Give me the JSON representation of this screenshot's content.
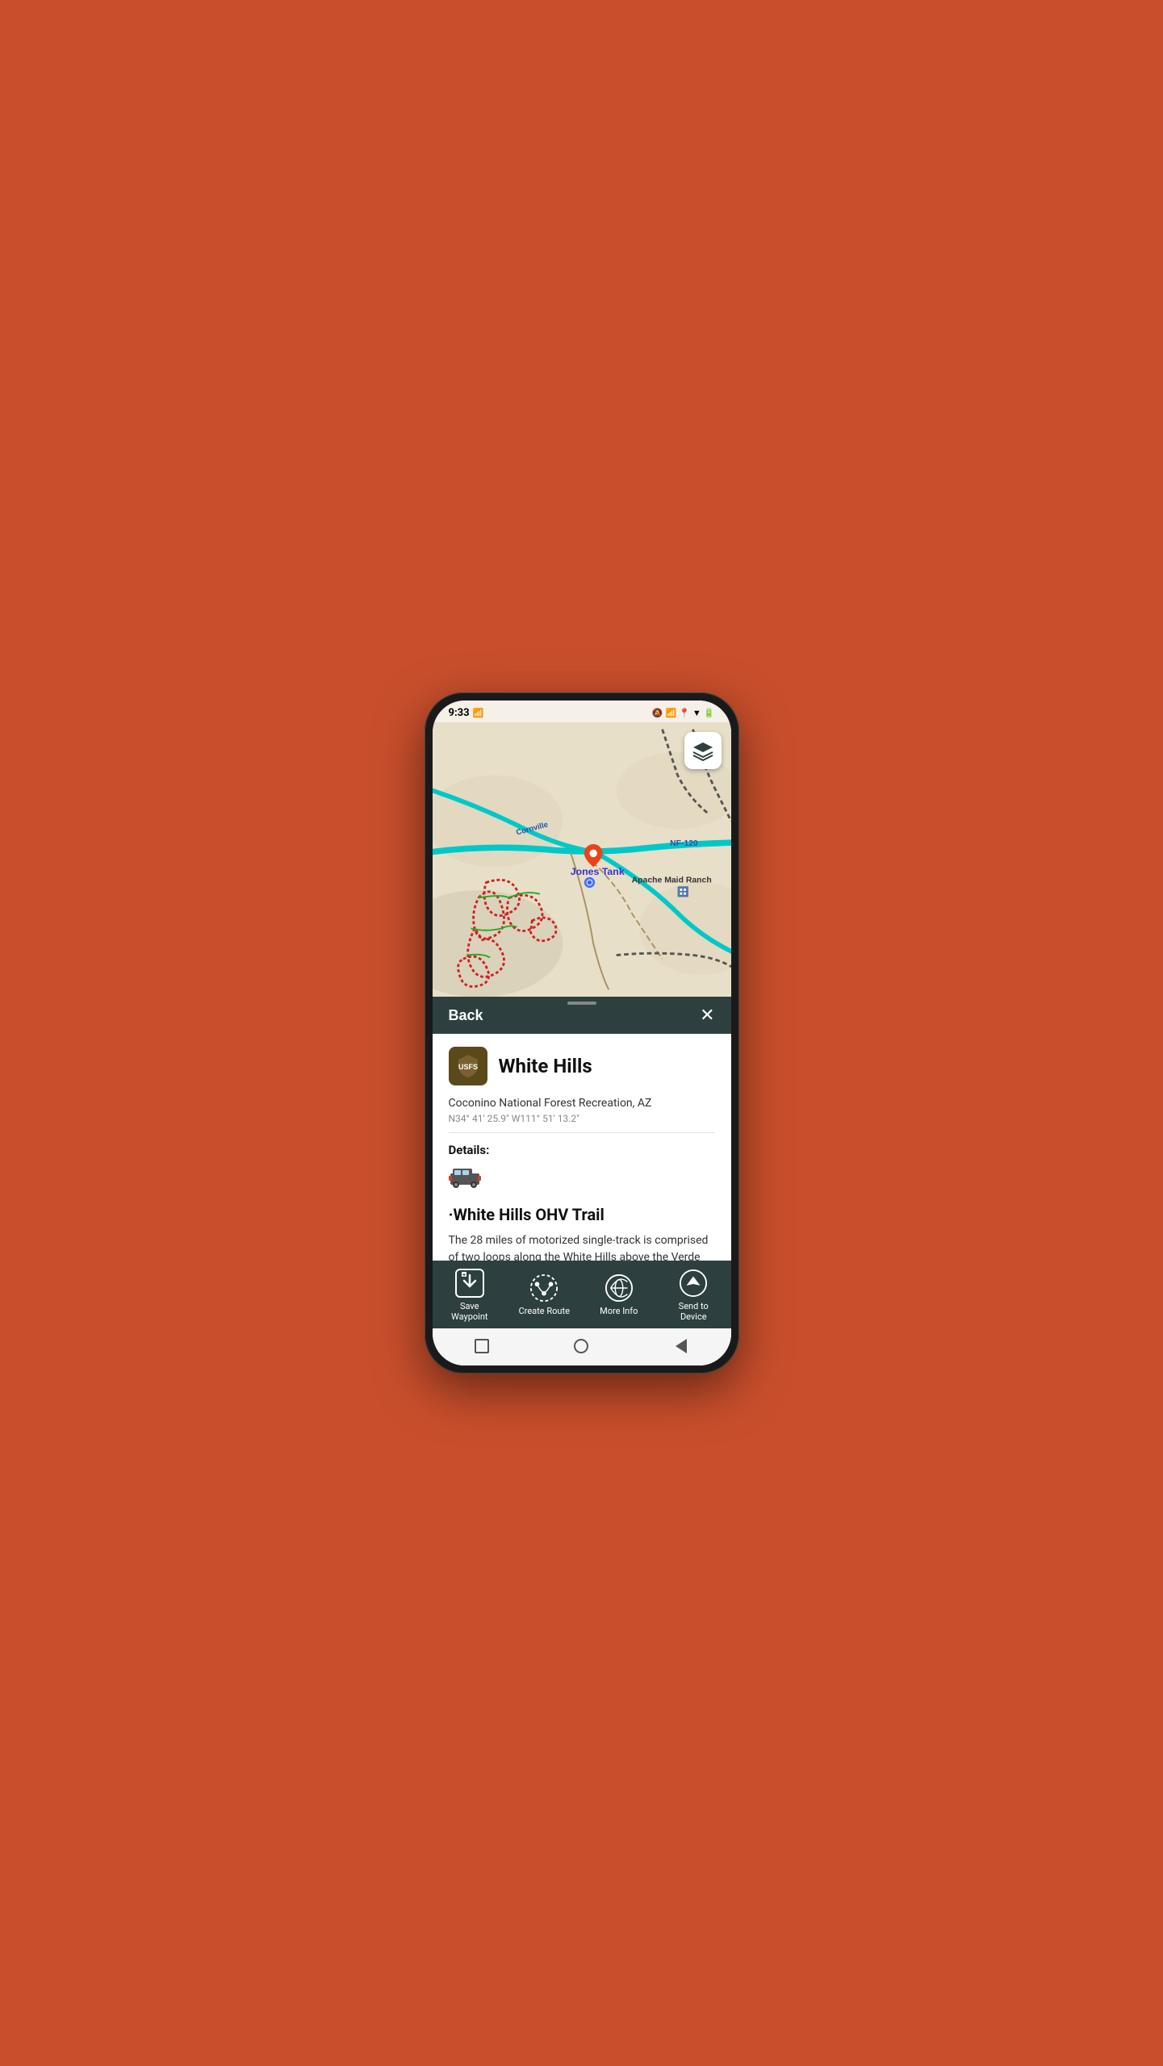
{
  "status_bar": {
    "time": "9:33",
    "icons_right": [
      "bell-slash-icon",
      "bluetooth-icon",
      "location-icon",
      "wifi-icon",
      "signal-icon",
      "battery-icon"
    ]
  },
  "map": {
    "location_name": "Jones Tank",
    "road_label": "NF-120",
    "ranch_label": "Apache Maid Ranch",
    "road_label2": "Cornville"
  },
  "sheet": {
    "back_label": "Back",
    "close_label": "✕",
    "poi_name": "White Hills",
    "poi_subtitle": "Coconino National Forest Recreation, AZ",
    "poi_coords": "N34° 41' 25.9\" W111° 51' 13.2\"",
    "details_label": "Details:",
    "trail_heading": "·White Hills OHV Trail",
    "trail_description": "The 28 miles of motorized single-track is comprised of two loops along the White Hills above the Verde River."
  },
  "action_bar": {
    "items": [
      {
        "id": "save-waypoint",
        "label": "Save\nWaypoint",
        "icon": "waypoint-icon"
      },
      {
        "id": "create-route",
        "label": "Create Route",
        "icon": "route-icon"
      },
      {
        "id": "more-info",
        "label": "More Info",
        "icon": "globe-icon"
      },
      {
        "id": "send-to-device",
        "label": "Send to\nDevice",
        "icon": "navigation-icon"
      }
    ]
  },
  "accent_color": "#c94f2c"
}
